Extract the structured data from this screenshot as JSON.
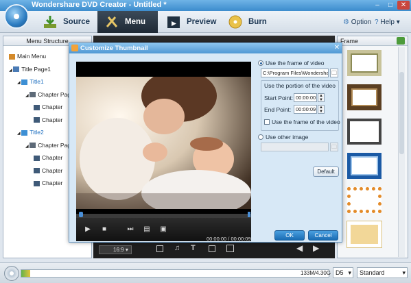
{
  "app": {
    "title": "Wondershare DVD Creator - Untitled *"
  },
  "window_controls": {
    "minimize": "–",
    "maximize": "□",
    "close": "✕"
  },
  "toolbar": {
    "tabs": [
      {
        "label": "Source",
        "icon": "download-arrow-icon"
      },
      {
        "label": "Menu",
        "icon": "wrench-tools-icon"
      },
      {
        "label": "Preview",
        "icon": "clapperboard-icon"
      },
      {
        "label": "Burn",
        "icon": "disc-burn-icon"
      }
    ],
    "option_label": "Option",
    "help_label": "Help"
  },
  "menu_structure": {
    "title": "Menu Structure",
    "items": [
      {
        "label": "Main Menu",
        "level": 0,
        "icon": "home-icon"
      },
      {
        "label": "Title Page1",
        "level": 0,
        "icon": "page-icon"
      },
      {
        "label": "Title1",
        "level": 1,
        "icon": "folder-icon"
      },
      {
        "label": "Chapter Pag",
        "level": 2,
        "icon": "film-icon"
      },
      {
        "label": "Chapter",
        "level": 3,
        "icon": "chapter-icon"
      },
      {
        "label": "Chapter",
        "level": 3,
        "icon": "chapter-icon"
      },
      {
        "label": "Title2",
        "level": 1,
        "icon": "folder-icon"
      },
      {
        "label": "Chapter Pag",
        "level": 2,
        "icon": "film-icon"
      },
      {
        "label": "Chapter",
        "level": 3,
        "icon": "chapter-icon"
      },
      {
        "label": "Chapter",
        "level": 3,
        "icon": "chapter-icon"
      },
      {
        "label": "Chapter",
        "level": 3,
        "icon": "chapter-icon"
      }
    ]
  },
  "frame_panel": {
    "title": "Frame"
  },
  "center_toolbar": {
    "aspect_ratio": "16:9"
  },
  "dialog": {
    "title": "Customize Thumbnail",
    "use_frame_label": "Use the frame of video",
    "path_value": "C:\\Program Files\\Wondershare\\DVD C",
    "portion_label": "Use the portion of the video",
    "start_label": "Start Point:",
    "start_value": "00:00:00",
    "end_label": "End Point:",
    "end_value": "00:00:09",
    "use_frame_check_label": "Use the frame of the video",
    "use_other_label": "Use other image",
    "default_label": "Default",
    "ok_label": "OK",
    "cancel_label": "Cancel",
    "timecode": "00:00:00 / 00:00:09"
  },
  "status": {
    "capacity": "133M/4.30G",
    "disc_type": "D5",
    "quality": "Standard",
    "capacity_fraction": 0.03
  }
}
